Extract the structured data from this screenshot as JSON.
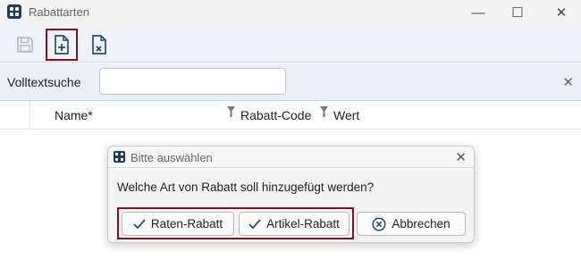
{
  "window": {
    "title": "Rabattarten",
    "minimize": "—",
    "maximize": "☐",
    "close": "✕"
  },
  "search": {
    "label": "Volltextsuche",
    "value": "",
    "placeholder": "",
    "clear": "✕"
  },
  "grid": {
    "columns": [
      "Name*",
      "Rabatt-Code",
      "Wert"
    ]
  },
  "dialog": {
    "title": "Bitte auswählen",
    "close": "✕",
    "message": "Welche Art von Rabatt soll hinzugefügt werden?",
    "buttons": {
      "raten": "Raten-Rabatt",
      "artikel": "Artikel-Rabatt",
      "cancel": "Abbrechen"
    }
  },
  "colors": {
    "accent": "#1f3b57",
    "highlight": "#7a1420"
  },
  "icons": {
    "save": "save-icon",
    "new": "new-document-icon",
    "delete": "delete-document-icon",
    "filter": "filter-icon",
    "check": "check-icon",
    "cancel": "cancel-circle-icon"
  }
}
